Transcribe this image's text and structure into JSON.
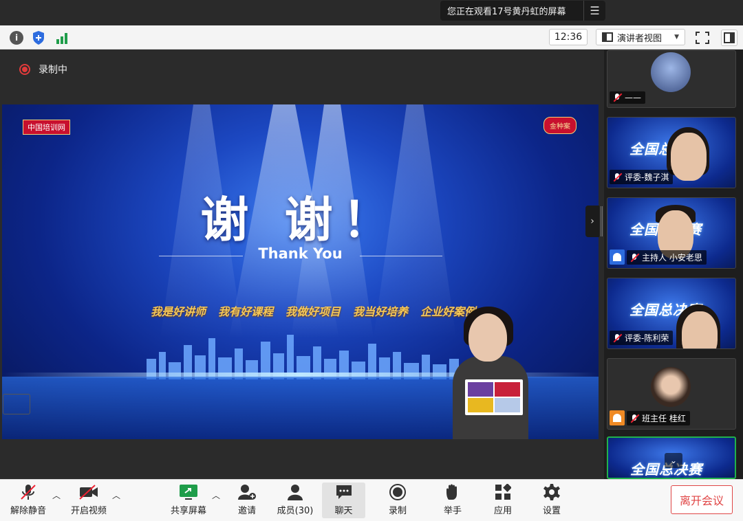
{
  "banner": {
    "text": "您正在观看17号黄丹虹的屏幕",
    "menu_icon": "list-menu-icon"
  },
  "topbar": {
    "time": "12:36",
    "view_mode": "演讲者视图"
  },
  "stage": {
    "recording": "录制中",
    "slide": {
      "logo_left": "中国培训网",
      "logo_right": "金种案",
      "title_cn": "谢 谢！",
      "title_en": "Thank You",
      "slogans": [
        "我是好讲师",
        "我有好课程",
        "我做好项目",
        "我当好培养",
        "企业好案例"
      ]
    }
  },
  "gallery": {
    "tiles": [
      {
        "name": "——"
      },
      {
        "name": "评委-魏子淇",
        "title": "全国总决赛"
      },
      {
        "name": "主持人 小安老思",
        "title": "全国总决赛"
      },
      {
        "name": "评委-陈利荣",
        "title": "全国总决赛"
      },
      {
        "name": "班主任 桂红"
      },
      {
        "name": "",
        "title": "全国总决赛"
      }
    ]
  },
  "toolbar": {
    "unmute": "解除静音",
    "start_video": "开启视频",
    "share_screen": "共享屏幕",
    "invite": "邀请",
    "members": "成员(30)",
    "chat": "聊天",
    "record": "录制",
    "raise_hand": "举手",
    "apps": "应用",
    "settings": "设置",
    "leave": "离开会议"
  },
  "colors": {
    "leave": "#e04545",
    "recording": "#e03b3b",
    "active_speaker": "#21b24b",
    "share_green": "#1f9d4a"
  }
}
